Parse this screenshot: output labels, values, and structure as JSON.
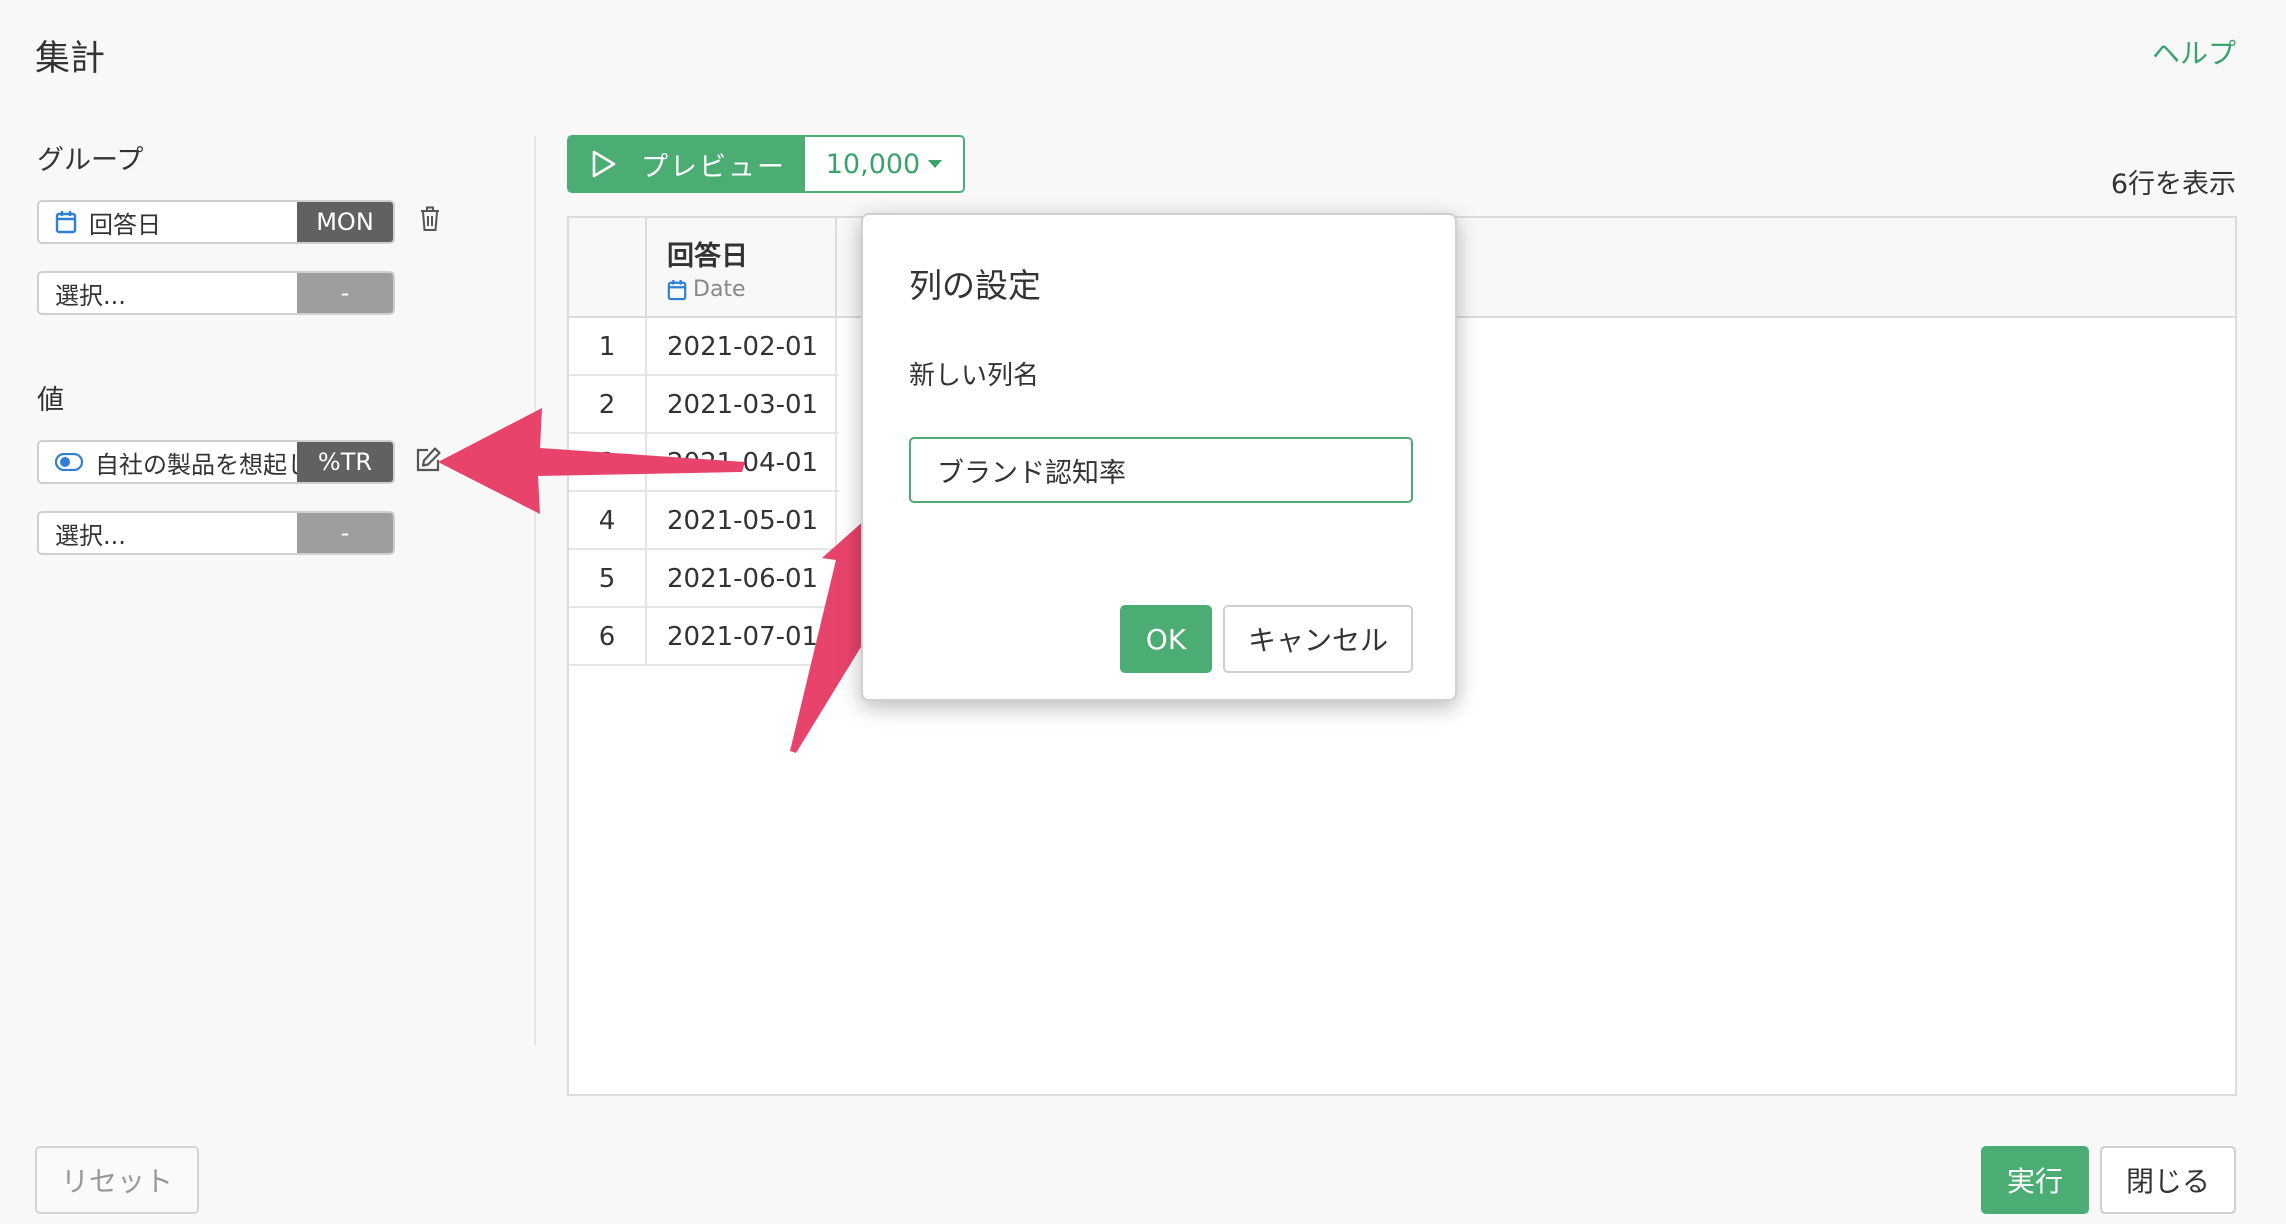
{
  "header": {
    "title": "集計",
    "help_label": "ヘルプ"
  },
  "sidebar": {
    "group_label": "グループ",
    "group_items": [
      {
        "label": "回答日",
        "tag": "MON"
      },
      {
        "label": "選択...",
        "tag": "-"
      }
    ],
    "value_label": "値",
    "value_items": [
      {
        "label": "自社の製品を想起し",
        "tag": "%TR"
      },
      {
        "label": "選択...",
        "tag": "-"
      }
    ]
  },
  "toolbar": {
    "preview_label": "プレビュー",
    "rows_limit": "10,000",
    "row_count": "6行を表示"
  },
  "table": {
    "column": {
      "name": "回答日",
      "type": "Date"
    },
    "rows": [
      {
        "idx": "1",
        "value": "2021-02-01"
      },
      {
        "idx": "2",
        "value": "2021-03-01"
      },
      {
        "idx": "3",
        "value": "2021-04-01"
      },
      {
        "idx": "4",
        "value": "2021-05-01"
      },
      {
        "idx": "5",
        "value": "2021-06-01"
      },
      {
        "idx": "6",
        "value": "2021-07-01"
      }
    ]
  },
  "dialog": {
    "title": "列の設定",
    "field_label": "新しい列名",
    "field_value": "ブランド認知率",
    "ok_label": "OK",
    "cancel_label": "キャンセル"
  },
  "footer": {
    "reset_label": "リセット",
    "run_label": "実行",
    "close_label": "閉じる"
  },
  "colors": {
    "accent": "#4cad74",
    "tag_dark": "#616161",
    "tag_empty": "#9e9e9e",
    "annotation_arrow": "#e8436b",
    "calendar_icon": "#2f7fd6",
    "toggle_icon": "#2f7fd6"
  },
  "icons": {
    "calendar": "calendar-icon",
    "toggle": "toggle-icon",
    "trash": "trash-icon",
    "edit": "edit-icon",
    "play": "play-icon",
    "caret": "caret-down-icon"
  }
}
